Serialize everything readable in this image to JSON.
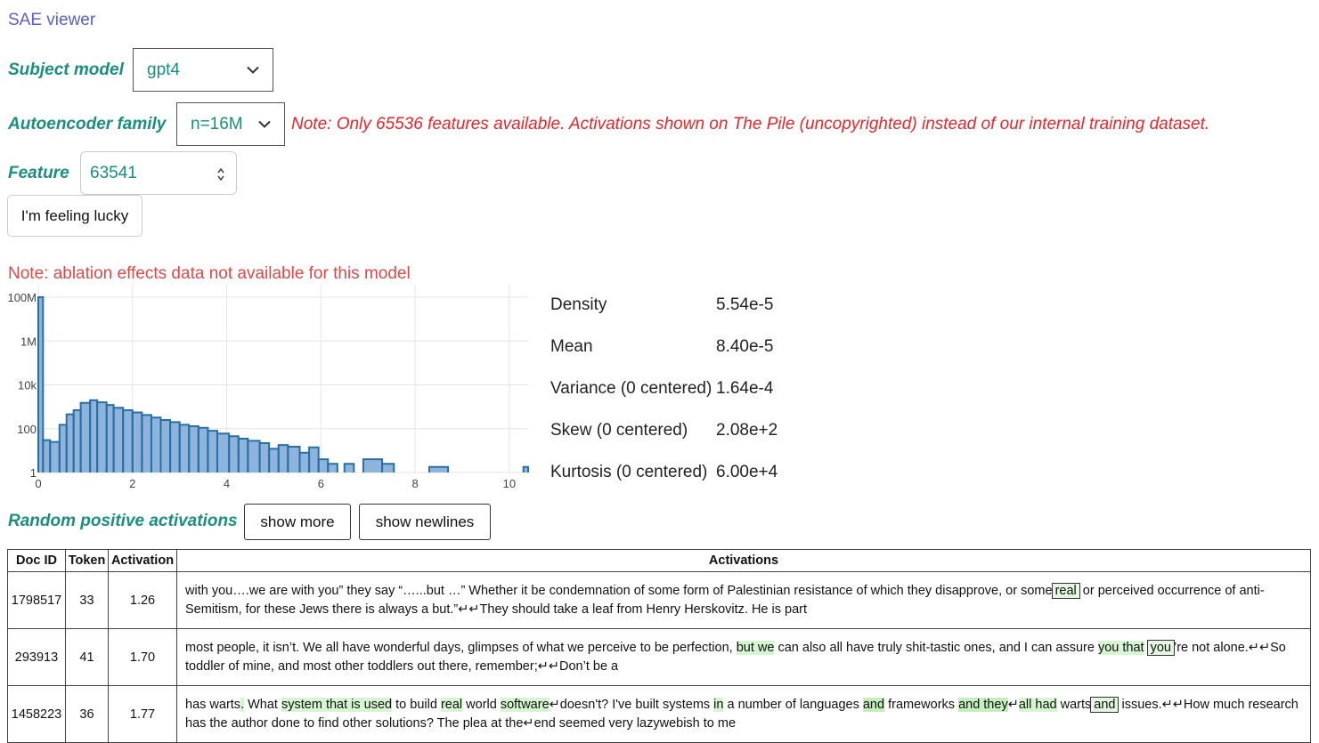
{
  "app": {
    "title": "SAE viewer"
  },
  "controls": {
    "subject_model": {
      "label": "Subject model",
      "value": "gpt4"
    },
    "autoencoder_family": {
      "label": "Autoencoder family",
      "value": "n=16M"
    },
    "feature_note": "Note: Only 65536 features available. Activations shown on The Pile (uncopyrighted) instead of our internal training dataset.",
    "feature": {
      "label": "Feature",
      "value": "63541"
    },
    "lucky_button": "I'm feeling lucky"
  },
  "ablation_note": "Note: ablation effects data not available for this model",
  "stats": [
    {
      "label": "Density",
      "value": "5.54e-5"
    },
    {
      "label": "Mean",
      "value": "8.40e-5"
    },
    {
      "label": "Variance (0 centered)",
      "value": "1.64e-4"
    },
    {
      "label": "Skew (0 centered)",
      "value": "2.08e+2"
    },
    {
      "label": "Kurtosis (0 centered)",
      "value": "6.00e+4"
    }
  ],
  "activations_section": {
    "title": "Random positive activations",
    "show_more": "show more",
    "show_newlines": "show newlines"
  },
  "table": {
    "headers": [
      "Doc ID",
      "Token",
      "Activation",
      "Activations"
    ],
    "rows": [
      {
        "doc_id": "1798517",
        "token": "33",
        "activation": "1.26"
      },
      {
        "doc_id": "293913",
        "token": "41",
        "activation": "1.70"
      },
      {
        "doc_id": "1458223",
        "token": "36",
        "activation": "1.77"
      }
    ]
  },
  "colors": {
    "accent": "#1a8f7e",
    "title": "#5b5fc7",
    "warning": "#e8262a",
    "bar_fill": "#8fb4dc",
    "bar_stroke": "#2a6ea6",
    "highlight": "#d6f5d1"
  },
  "chart_data": {
    "type": "bar",
    "ylog": true,
    "ytick_labels": [
      "100M",
      "1M",
      "10k",
      "100",
      "1"
    ],
    "ytick_values": [
      100000000,
      1000000,
      10000,
      100,
      1
    ],
    "xtick_labels": [
      "0",
      "2",
      "4",
      "6",
      "8",
      "10"
    ],
    "xlim": [
      0,
      10.4
    ],
    "ylim": [
      1,
      100000000
    ],
    "grid": true,
    "bins": [
      {
        "x0": 0.0,
        "x1": 0.1,
        "y": 100000000
      },
      {
        "x0": 0.1,
        "x1": 0.25,
        "y": 30
      },
      {
        "x0": 0.25,
        "x1": 0.45,
        "y": 25
      },
      {
        "x0": 0.45,
        "x1": 0.6,
        "y": 150
      },
      {
        "x0": 0.6,
        "x1": 0.75,
        "y": 450
      },
      {
        "x0": 0.75,
        "x1": 0.9,
        "y": 700
      },
      {
        "x0": 0.9,
        "x1": 1.1,
        "y": 1500
      },
      {
        "x0": 1.1,
        "x1": 1.25,
        "y": 2000
      },
      {
        "x0": 1.25,
        "x1": 1.45,
        "y": 1600
      },
      {
        "x0": 1.45,
        "x1": 1.6,
        "y": 1200
      },
      {
        "x0": 1.6,
        "x1": 1.8,
        "y": 900
      },
      {
        "x0": 1.8,
        "x1": 2.0,
        "y": 700
      },
      {
        "x0": 2.0,
        "x1": 2.2,
        "y": 550
      },
      {
        "x0": 2.2,
        "x1": 2.4,
        "y": 420
      },
      {
        "x0": 2.4,
        "x1": 2.6,
        "y": 320
      },
      {
        "x0": 2.6,
        "x1": 2.8,
        "y": 250
      },
      {
        "x0": 2.8,
        "x1": 3.0,
        "y": 200
      },
      {
        "x0": 3.0,
        "x1": 3.2,
        "y": 150
      },
      {
        "x0": 3.2,
        "x1": 3.4,
        "y": 130
      },
      {
        "x0": 3.4,
        "x1": 3.6,
        "y": 110
      },
      {
        "x0": 3.6,
        "x1": 3.8,
        "y": 80
      },
      {
        "x0": 3.8,
        "x1": 4.05,
        "y": 60
      },
      {
        "x0": 4.05,
        "x1": 4.25,
        "y": 45
      },
      {
        "x0": 4.25,
        "x1": 4.45,
        "y": 35
      },
      {
        "x0": 4.45,
        "x1": 4.7,
        "y": 28
      },
      {
        "x0": 4.7,
        "x1": 4.9,
        "y": 22
      },
      {
        "x0": 4.9,
        "x1": 5.1,
        "y": 12
      },
      {
        "x0": 5.1,
        "x1": 5.3,
        "y": 18
      },
      {
        "x0": 5.3,
        "x1": 5.55,
        "y": 15
      },
      {
        "x0": 5.55,
        "x1": 5.75,
        "y": 8
      },
      {
        "x0": 5.75,
        "x1": 5.95,
        "y": 14
      },
      {
        "x0": 5.95,
        "x1": 6.15,
        "y": 4
      },
      {
        "x0": 6.15,
        "x1": 6.35,
        "y": 2.5
      },
      {
        "x0": 6.5,
        "x1": 6.7,
        "y": 2.5
      },
      {
        "x0": 6.9,
        "x1": 7.3,
        "y": 4
      },
      {
        "x0": 7.3,
        "x1": 7.55,
        "y": 2.5
      },
      {
        "x0": 8.3,
        "x1": 8.7,
        "y": 1.8
      },
      {
        "x0": 10.3,
        "x1": 10.4,
        "y": 1.8
      }
    ]
  }
}
